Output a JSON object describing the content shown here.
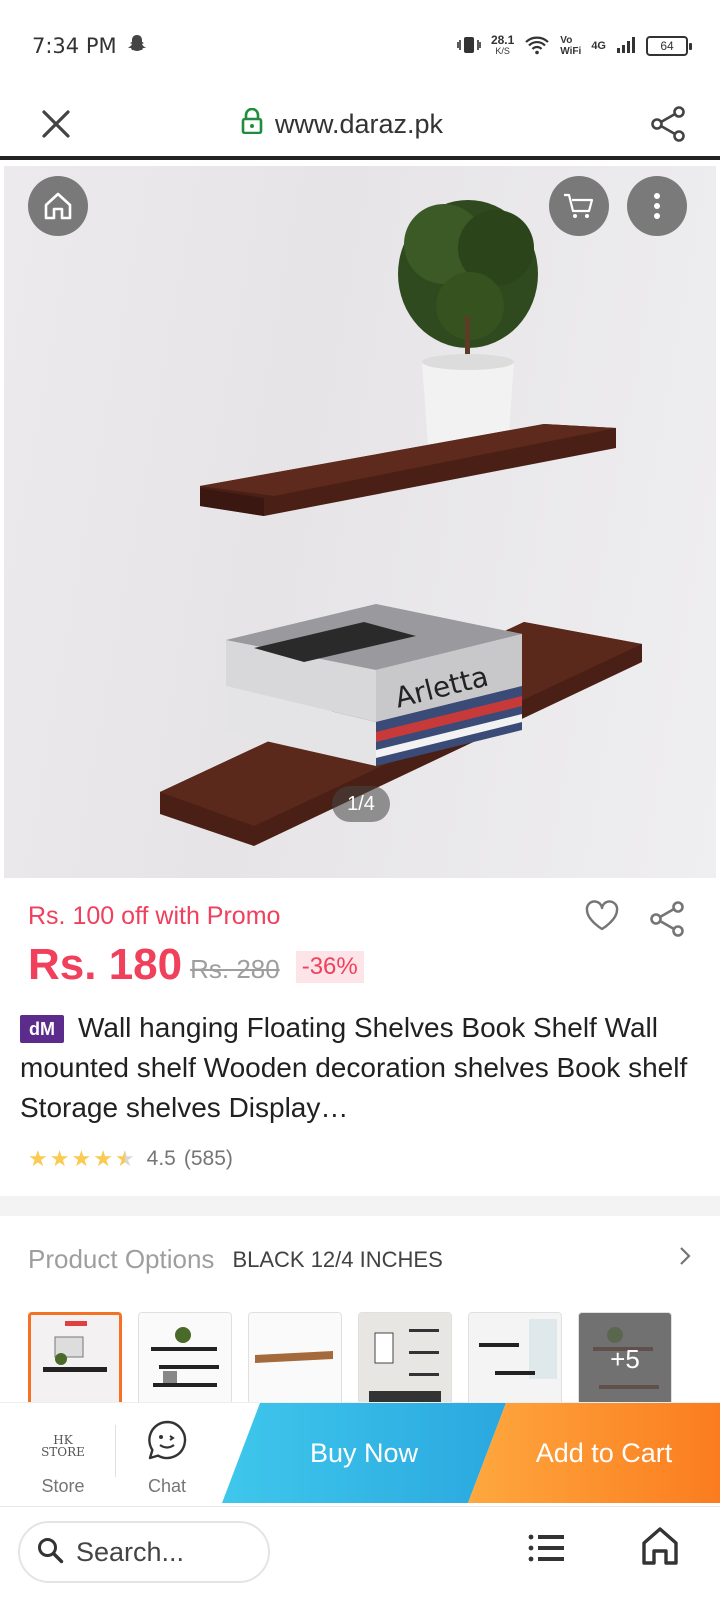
{
  "status_bar": {
    "time": "7:34 PM",
    "net_speed": "28.1",
    "net_unit": "K/S",
    "vo": "Vo",
    "wifi_label": "WiFi",
    "network": "4G",
    "battery": "64"
  },
  "browser": {
    "url": "www.daraz.pk"
  },
  "gallery": {
    "counter": "1/4",
    "icons": [
      "home-icon",
      "cart-icon",
      "more-vertical-icon"
    ]
  },
  "product": {
    "promo": "Rs. 100 off with Promo",
    "price": "Rs. 180",
    "old_price": "Rs. 280",
    "discount": "-36%",
    "badge": "dM",
    "title": "Wall hanging Floating Shelves Book Shelf Wall mounted shelf Wooden decoration shelves Book shelf Storage shelves Display…",
    "rating_value": "4.5",
    "rating_count": "(585)",
    "stars": 4.5
  },
  "options": {
    "label": "Product Options",
    "value": "BLACK 12/4 INCHES",
    "more_count": "+5"
  },
  "actions": {
    "store_label": "Store",
    "store_logo_line1": "HK",
    "store_logo_line2": "STORE",
    "chat_label": "Chat",
    "buy_now": "Buy Now",
    "add_to_cart": "Add to Cart"
  },
  "bottom_bar": {
    "search_placeholder": "Search..."
  },
  "colors": {
    "price_red": "#f0405c",
    "buy_now_blue": "#2aa8df",
    "add_cart_orange": "#fb7c1e",
    "selected_border": "#f57224",
    "star": "#faca51"
  }
}
